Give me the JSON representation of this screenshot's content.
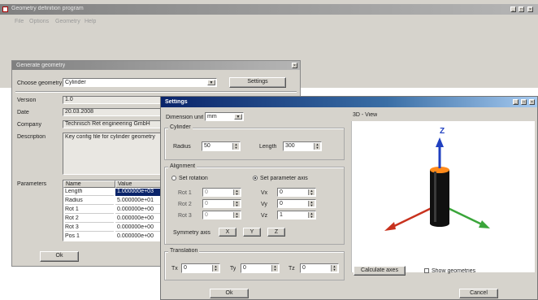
{
  "app": {
    "title": "Geometry definition program",
    "menu": [
      "File",
      "Options",
      "Geometry",
      "Help"
    ],
    "title_buttons": [
      "_",
      "□",
      "×"
    ]
  },
  "gen_dialog": {
    "title": "Generate geometry",
    "choose_label": "Choose geometry",
    "choose_value": "Cylinder",
    "settings_button": "Settings",
    "version_label": "Version",
    "version_value": "1.0",
    "date_label": "Date",
    "date_value": "20.03.2008",
    "company_label": "Company",
    "company_value": "Technisch Ret engineering GmbH",
    "description_label": "Description",
    "description_value": "Key config file for cylinder geometry",
    "parameters_label": "Parameters",
    "param_columns": [
      "Name",
      "Value"
    ],
    "params": [
      {
        "name": "Length",
        "value": "1.000000e+03"
      },
      {
        "name": "Radius",
        "value": "5.000000e+01"
      },
      {
        "name": "Rot 1",
        "value": "0.000000e+00"
      },
      {
        "name": "Rot 2",
        "value": "0.000000e+00"
      },
      {
        "name": "Rot 3",
        "value": "0.000000e+00"
      },
      {
        "name": "Pos 1",
        "value": "0.000000e+00"
      }
    ],
    "ok_button": "Ok"
  },
  "settings": {
    "title": "Settings",
    "dimension_label": "Dimension unit",
    "dimension_value": "mm",
    "cylinder_group": "Cylinder",
    "radius_label": "Radius",
    "radius_value": "50",
    "length_label": "Length",
    "length_value": "300",
    "alignment_group": "Alignment",
    "rotation_label": "Set rotation",
    "parameter_label": "Set parameter axis",
    "rot_labels": [
      "Rot 1",
      "Rot 2",
      "Rot 3"
    ],
    "rot_values": [
      "0",
      "0",
      "0"
    ],
    "axis_labels": [
      "Vx",
      "Vy",
      "Vz"
    ],
    "axis_values": [
      "0",
      "0",
      "1"
    ],
    "symmetry_label": "Symmetry axis",
    "symmetry_buttons": [
      "X",
      "Y",
      "Z"
    ],
    "translation_group": "Translation",
    "trans_labels": [
      "Tx",
      "Ty",
      "Tz"
    ],
    "trans_values": [
      "0",
      "0",
      "0"
    ],
    "view_label": "3D - View",
    "axis_z": "Z",
    "calc_button": "Calculate axes",
    "show_geometries_label": "Show geometries",
    "ok_button": "Ok",
    "cancel_button": "Cancel"
  }
}
